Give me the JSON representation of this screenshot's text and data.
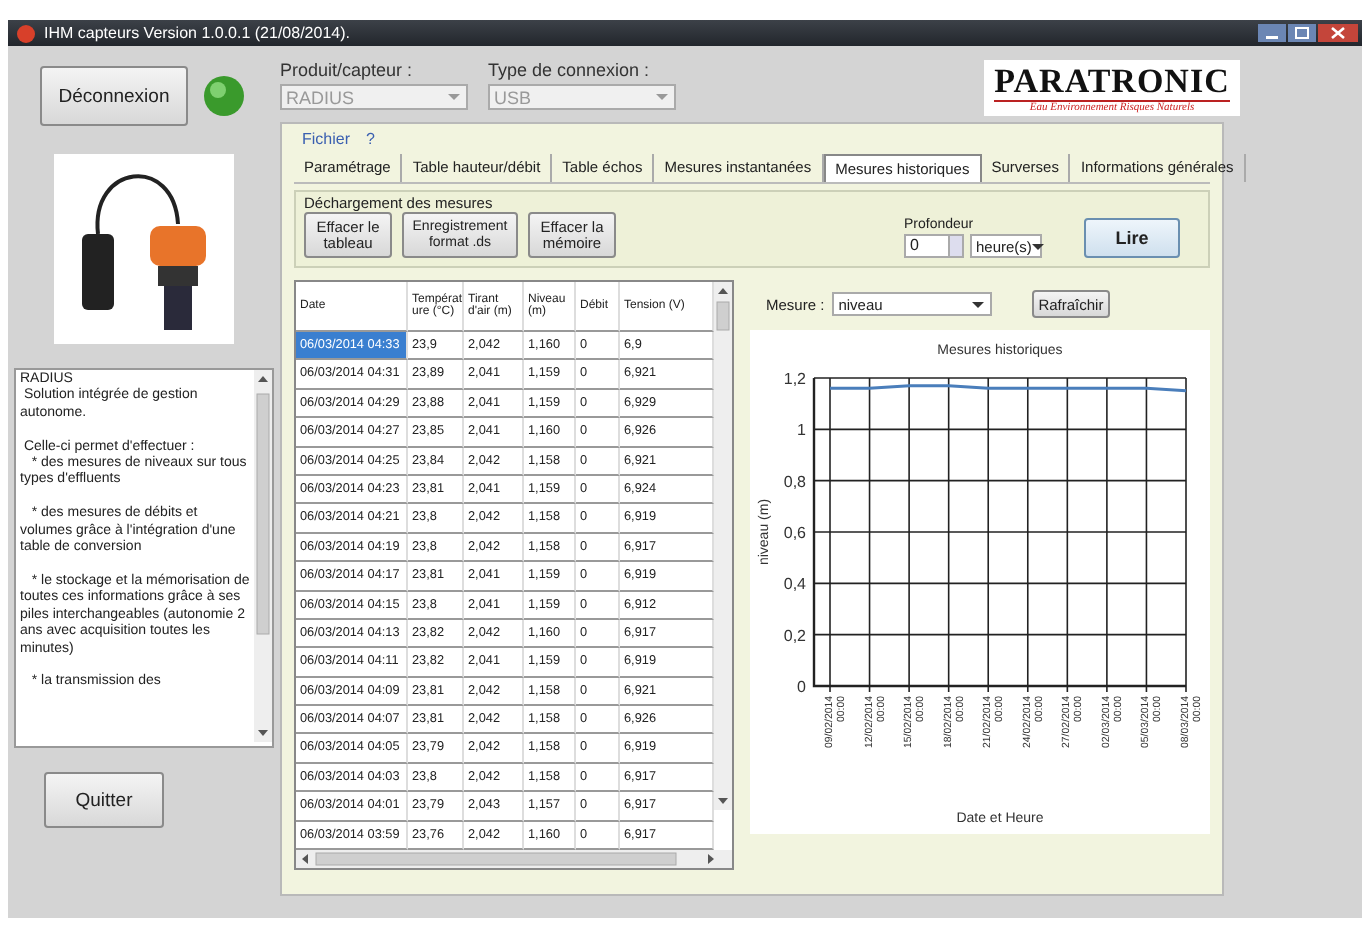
{
  "window": {
    "title": "IHM capteurs Version 1.0.0.1 (21/08/2014)."
  },
  "connection": {
    "button": "Déconnexion",
    "connected": true
  },
  "product": {
    "label": "Produit/capteur :",
    "value": "RADIUS",
    "disabled": true
  },
  "connection_type": {
    "label": "Type de connexion :",
    "value": "USB",
    "disabled": true
  },
  "logo": {
    "name": "PARATRONIC",
    "tagline": "Eau Environnement Risques Naturels"
  },
  "description": "RADIUS\n Solution intégrée de gestion autonome.\n\n Celle-ci permet d'effectuer :\n   * des mesures de niveaux sur tous types d'effluents\n\n   * des mesures de débits et volumes grâce à l'intégration d'une table de conversion\n\n   * le stockage et la mémorisation de toutes ces informations grâce à ses piles interchangeables (autonomie 2 ans avec acquisition toutes les minutes)\n\n   * la transmission des",
  "quit_button": "Quitter",
  "menu": [
    "Fichier",
    "?"
  ],
  "tabs": [
    {
      "label": "Paramétrage",
      "selected": false
    },
    {
      "label": "Table hauteur/débit",
      "selected": false
    },
    {
      "label": "Table échos",
      "selected": false
    },
    {
      "label": "Mesures instantanées",
      "selected": false
    },
    {
      "label": "Mesures historiques",
      "selected": true
    },
    {
      "label": "Surverses",
      "selected": false
    },
    {
      "label": "Informations générales",
      "selected": false
    }
  ],
  "download_group": {
    "title": "Déchargement des mesures",
    "buttons": [
      "Effacer le tableau",
      "Enregistrement format .ds",
      "Effacer la mémoire"
    ],
    "depth_label": "Profondeur",
    "depth_value": "0",
    "unit": "heure(s)",
    "read_button": "Lire"
  },
  "table": {
    "columns": [
      "Date",
      "Température (°C)",
      "Tirant d'air (m)",
      "Niveau (m)",
      "Débit",
      "Tension (V)"
    ],
    "rows": [
      {
        "cells": [
          "06/03/2014 04:33",
          "23,9",
          "2,042",
          "1,160",
          "0",
          "6,9"
        ],
        "selected": true
      },
      {
        "cells": [
          "06/03/2014 04:31",
          "23,89",
          "2,041",
          "1,159",
          "0",
          "6,921"
        ],
        "selected": false
      },
      {
        "cells": [
          "06/03/2014 04:29",
          "23,88",
          "2,041",
          "1,159",
          "0",
          "6,929"
        ],
        "selected": false
      },
      {
        "cells": [
          "06/03/2014 04:27",
          "23,85",
          "2,041",
          "1,160",
          "0",
          "6,926"
        ],
        "selected": false
      },
      {
        "cells": [
          "06/03/2014 04:25",
          "23,84",
          "2,042",
          "1,158",
          "0",
          "6,921"
        ],
        "selected": false
      },
      {
        "cells": [
          "06/03/2014 04:23",
          "23,81",
          "2,041",
          "1,159",
          "0",
          "6,924"
        ],
        "selected": false
      },
      {
        "cells": [
          "06/03/2014 04:21",
          "23,8",
          "2,042",
          "1,158",
          "0",
          "6,919"
        ],
        "selected": false
      },
      {
        "cells": [
          "06/03/2014 04:19",
          "23,8",
          "2,042",
          "1,158",
          "0",
          "6,917"
        ],
        "selected": false
      },
      {
        "cells": [
          "06/03/2014 04:17",
          "23,81",
          "2,041",
          "1,159",
          "0",
          "6,919"
        ],
        "selected": false
      },
      {
        "cells": [
          "06/03/2014 04:15",
          "23,8",
          "2,041",
          "1,159",
          "0",
          "6,912"
        ],
        "selected": false
      },
      {
        "cells": [
          "06/03/2014 04:13",
          "23,82",
          "2,042",
          "1,160",
          "0",
          "6,917"
        ],
        "selected": false
      },
      {
        "cells": [
          "06/03/2014 04:11",
          "23,82",
          "2,041",
          "1,159",
          "0",
          "6,919"
        ],
        "selected": false
      },
      {
        "cells": [
          "06/03/2014 04:09",
          "23,81",
          "2,042",
          "1,158",
          "0",
          "6,921"
        ],
        "selected": false
      },
      {
        "cells": [
          "06/03/2014 04:07",
          "23,81",
          "2,042",
          "1,158",
          "0",
          "6,926"
        ],
        "selected": false
      },
      {
        "cells": [
          "06/03/2014 04:05",
          "23,79",
          "2,042",
          "1,158",
          "0",
          "6,919"
        ],
        "selected": false
      },
      {
        "cells": [
          "06/03/2014 04:03",
          "23,8",
          "2,042",
          "1,158",
          "0",
          "6,917"
        ],
        "selected": false
      },
      {
        "cells": [
          "06/03/2014 04:01",
          "23,79",
          "2,043",
          "1,157",
          "0",
          "6,917"
        ],
        "selected": false
      },
      {
        "cells": [
          "06/03/2014 03:59",
          "23,76",
          "2,042",
          "1,160",
          "0",
          "6,917"
        ],
        "selected": false
      }
    ]
  },
  "measure": {
    "label": "Mesure :",
    "value": "niveau",
    "refresh_button": "Rafraîchir"
  },
  "chart": {
    "chart_data": {
      "type": "line",
      "title": "Mesures historiques",
      "xlabel": "Date et Heure",
      "ylabel": "niveau (m)",
      "categories": [
        "09/02/2014 00:00",
        "12/02/2014 00:00",
        "15/02/2014 00:00",
        "18/02/2014 00:00",
        "21/02/2014 00:00",
        "24/02/2014 00:00",
        "27/02/2014 00:00",
        "02/03/2014 00:00",
        "05/03/2014 00:00",
        "08/03/2014 00:00"
      ],
      "grid": true,
      "series": [
        {
          "color": "#4a7ebb",
          "values": [
            1.16,
            1.16,
            1.17,
            1.17,
            1.16,
            1.16,
            1.16,
            1.16,
            1.16,
            1.15
          ]
        }
      ],
      "ylim": [
        0,
        1.2
      ],
      "yticks": [
        {
          "value": 0,
          "label": "0"
        },
        {
          "value": 0.2,
          "label": "0,2"
        },
        {
          "value": 0.4,
          "label": "0,4"
        },
        {
          "value": 0.6,
          "label": "0,6"
        },
        {
          "value": 0.8,
          "label": "0,8"
        },
        {
          "value": 1,
          "label": "1"
        },
        {
          "value": 1.2,
          "label": "1,2"
        }
      ]
    }
  }
}
